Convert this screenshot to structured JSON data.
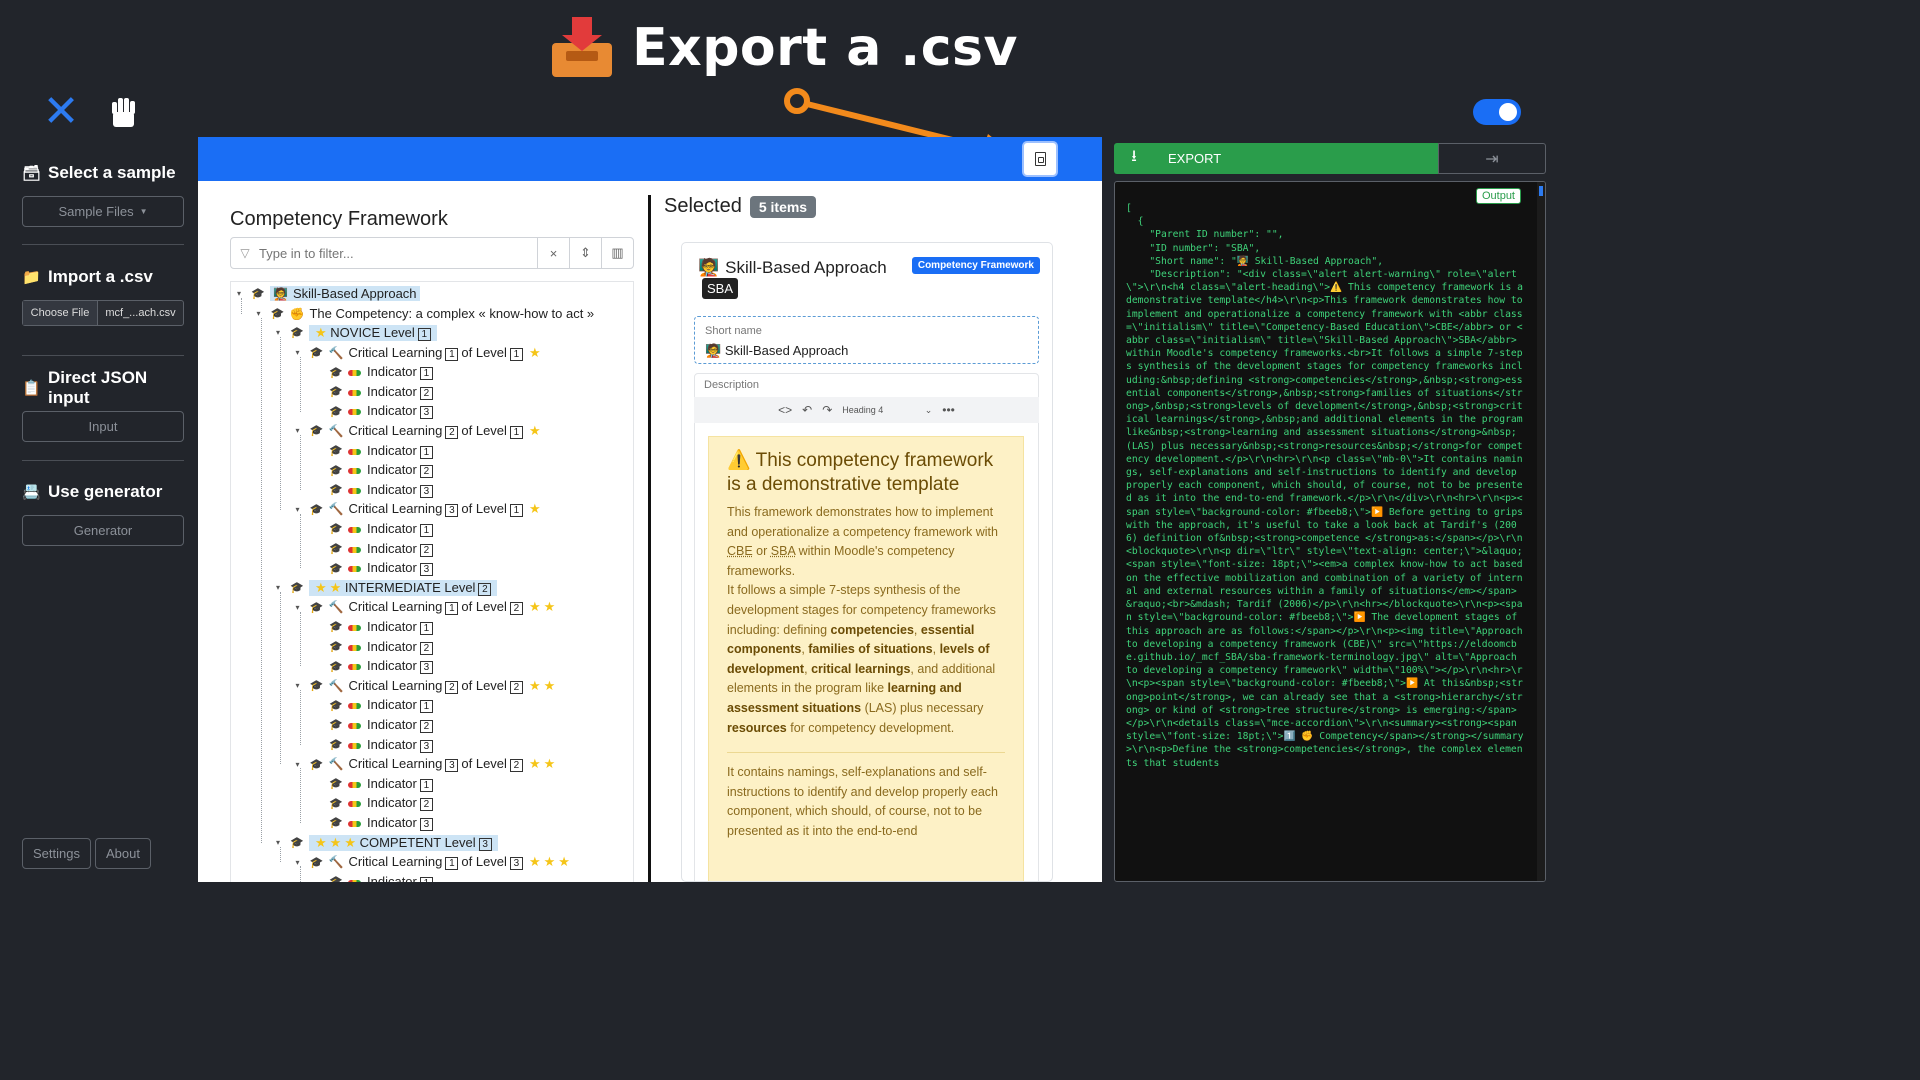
{
  "banner": {
    "title": "Export a .csv",
    "icon": "inbox-tray-icon"
  },
  "header": {
    "close_icon": "close-icon",
    "fist_icon": "fist-icon",
    "toggle_on": true
  },
  "sidebar": {
    "sample": {
      "heading": "Select a sample",
      "button": "Sample Files"
    },
    "import": {
      "heading": "Import a .csv",
      "choose_label": "Choose File",
      "file_name": "mcf_...ach.csv"
    },
    "json": {
      "heading": "Direct JSON input",
      "button": "Input"
    },
    "generator": {
      "heading": "Use generator",
      "button": "Generator"
    },
    "settings": "Settings",
    "about": "About"
  },
  "framework": {
    "title": "Competency Framework",
    "filter_placeholder": "Type in to filter...",
    "tree": [
      {
        "lvl": 0,
        "toggle": "▾",
        "text": "Skill-Based Approach",
        "icon": "🧑‍🏫",
        "hl": true
      },
      {
        "lvl": 1,
        "toggle": "▾",
        "text": "The Competency: a complex « know-how to act »",
        "icon": "✊"
      },
      {
        "lvl": 2,
        "toggle": "▾",
        "pre": "NOVICE Level",
        "num": "1",
        "stars": 0,
        "lead_stars": 1,
        "hl": true
      },
      {
        "lvl": 3,
        "toggle": "▾",
        "pre": "Critical Learning",
        "num": "1",
        "post": "of Level",
        "num2": "1",
        "stars": 1,
        "icon": "🔨"
      },
      {
        "lvl": 4,
        "pre": "Indicator",
        "num": "1",
        "ind": true
      },
      {
        "lvl": 4,
        "pre": "Indicator",
        "num": "2",
        "ind": true
      },
      {
        "lvl": 4,
        "pre": "Indicator",
        "num": "3",
        "ind": true
      },
      {
        "lvl": 3,
        "toggle": "▾",
        "pre": "Critical Learning",
        "num": "2",
        "post": "of Level",
        "num2": "1",
        "stars": 1,
        "icon": "🔨"
      },
      {
        "lvl": 4,
        "pre": "Indicator",
        "num": "1",
        "ind": true
      },
      {
        "lvl": 4,
        "pre": "Indicator",
        "num": "2",
        "ind": true
      },
      {
        "lvl": 4,
        "pre": "Indicator",
        "num": "3",
        "ind": true
      },
      {
        "lvl": 3,
        "toggle": "▾",
        "pre": "Critical Learning",
        "num": "3",
        "post": "of Level",
        "num2": "1",
        "stars": 1,
        "icon": "🔨"
      },
      {
        "lvl": 4,
        "pre": "Indicator",
        "num": "1",
        "ind": true
      },
      {
        "lvl": 4,
        "pre": "Indicator",
        "num": "2",
        "ind": true
      },
      {
        "lvl": 4,
        "pre": "Indicator",
        "num": "3",
        "ind": true
      },
      {
        "lvl": 2,
        "toggle": "▾",
        "pre": "INTERMEDIATE Level",
        "num": "2",
        "lead_stars": 2,
        "hl": true
      },
      {
        "lvl": 3,
        "toggle": "▾",
        "pre": "Critical Learning",
        "num": "1",
        "post": "of Level",
        "num2": "2",
        "stars": 2,
        "icon": "🔨"
      },
      {
        "lvl": 4,
        "pre": "Indicator",
        "num": "1",
        "ind": true
      },
      {
        "lvl": 4,
        "pre": "Indicator",
        "num": "2",
        "ind": true
      },
      {
        "lvl": 4,
        "pre": "Indicator",
        "num": "3",
        "ind": true
      },
      {
        "lvl": 3,
        "toggle": "▾",
        "pre": "Critical Learning",
        "num": "2",
        "post": "of Level",
        "num2": "2",
        "stars": 2,
        "icon": "🔨"
      },
      {
        "lvl": 4,
        "pre": "Indicator",
        "num": "1",
        "ind": true
      },
      {
        "lvl": 4,
        "pre": "Indicator",
        "num": "2",
        "ind": true
      },
      {
        "lvl": 4,
        "pre": "Indicator",
        "num": "3",
        "ind": true
      },
      {
        "lvl": 3,
        "toggle": "▾",
        "pre": "Critical Learning",
        "num": "3",
        "post": "of Level",
        "num2": "2",
        "stars": 2,
        "icon": "🔨"
      },
      {
        "lvl": 4,
        "pre": "Indicator",
        "num": "1",
        "ind": true
      },
      {
        "lvl": 4,
        "pre": "Indicator",
        "num": "2",
        "ind": true
      },
      {
        "lvl": 4,
        "pre": "Indicator",
        "num": "3",
        "ind": true
      },
      {
        "lvl": 2,
        "toggle": "▾",
        "pre": "COMPETENT Level",
        "num": "3",
        "lead_stars": 3,
        "hl": true
      },
      {
        "lvl": 3,
        "toggle": "▾",
        "pre": "Critical Learning",
        "num": "1",
        "post": "of Level",
        "num2": "3",
        "stars": 3,
        "icon": "🔨"
      },
      {
        "lvl": 4,
        "pre": "Indicator",
        "num": "1",
        "ind": true
      }
    ]
  },
  "selected": {
    "title": "Selected",
    "count_badge": "5 items",
    "card": {
      "name": "Skill-Based Approach",
      "type_badge": "Competency Framework",
      "id_badge": "SBA",
      "short_name_label": "Short name",
      "short_name_value": "Skill-Based Approach",
      "description_label": "Description",
      "heading_select": "Heading 4",
      "alert_heading": "This competency framework is a demonstrative template",
      "p1a": "This framework demonstrates how to implement and operationalize a competency framework with ",
      "abbr1": "CBE",
      "p1b": " or ",
      "abbr2": "SBA",
      "p1c": " within Moodle's competency frameworks.",
      "p2a": "It follows a simple 7-steps synthesis of the development stages for competency frameworks including: defining ",
      "b1": "competencies",
      "b2": "essential components",
      "b3": "families of situations",
      "b4": "levels of development",
      "b5": "critical learnings",
      "p2b": ", and additional elements in the program like ",
      "b6": "learning and assessment situations",
      "p2c": " (LAS) plus necessary ",
      "b7": "resources",
      "p2d": " for competency development.",
      "p3": "It contains namings, self-explanations and self-instructions to identify and develop properly each component, which should, of course, not to be presented as it into the end-to-end"
    }
  },
  "export": {
    "button": "EXPORT",
    "output_badge": "Output",
    "json_text": "[\n  {\n    \"Parent ID number\": \"\",\n    \"ID number\": \"SBA\",\n    \"Short name\": \"🧑‍🏫 Skill-Based Approach\",\n    \"Description\": \"<div class=\\\"alert alert-warning\\\" role=\\\"alert\\\">\\r\\n<h4 class=\\\"alert-heading\\\">⚠️ This competency framework is a demonstrative template</h4>\\r\\n<p>This framework demonstrates how to implement and operationalize a competency framework with <abbr class=\\\"initialism\\\" title=\\\"Competency-Based Education\\\">CBE</abbr> or <abbr class=\\\"initialism\\\" title=\\\"Skill-Based Approach\\\">SBA</abbr> within Moodle's competency frameworks.<br>It follows a simple 7-steps synthesis of the development stages for competency frameworks including:&nbsp;defining <strong>competencies</strong>,&nbsp;<strong>essential components</strong>,&nbsp;<strong>families of situations</strong>,&nbsp;<strong>levels of development</strong>,&nbsp;<strong>critical learnings</strong>,&nbsp;and additional elements in the program like&nbsp;<strong>learning and assessment situations</strong>&nbsp;(LAS) plus necessary&nbsp;<strong>resources&nbsp;</strong>for competency development.</p>\\r\\n<hr>\\r\\n<p class=\\\"mb-0\\\">It contains namings, self-explanations and self-instructions to identify and develop properly each component, which should, of course, not to be presented as it into the end-to-end framework.</p>\\r\\n</div>\\r\\n<hr>\\r\\n<p><span style=\\\"background-color: #fbeeb8;\\\">▶️ Before getting to grips with the approach, it's useful to take a look back at Tardif's (2006) definition of&nbsp;<strong>competence </strong>as:</span></p>\\r\\n<blockquote>\\r\\n<p dir=\\\"ltr\\\" style=\\\"text-align: center;\\\">&laquo; <span style=\\\"font-size: 18pt;\\\"><em>a complex know-how to act based on the effective mobilization and combination of a variety of internal and external resources within a family of situations</em></span> &raquo;<br>&mdash; Tardif (2006)</p>\\r\\n<hr></blockquote>\\r\\n<p><span style=\\\"background-color: #fbeeb8;\\\">▶️ The development stages of this approach are as follows:</span></p>\\r\\n<p><img title=\\\"Approach to developing a competency framework (CBE)\\\" src=\\\"https://eldoomcbe.github.io/_mcf_SBA/sba-framework-terminology.jpg\\\" alt=\\\"Approach to developing a competency framework\\\" width=\\\"100%\\\"></p>\\r\\n<hr>\\r\\n<p><span style=\\\"background-color: #fbeeb8;\\\">▶️ At this&nbsp;<strong>point</strong>, we can already see that a <strong>hierarchy</strong> or kind of <strong>tree structure</strong> is emerging:</span></p>\\r\\n<details class=\\\"mce-accordion\\\">\\r\\n<summary><strong><span style=\\\"font-size: 18pt;\\\">1️⃣ ✊ Competency</span></strong></summary>\\r\\n<p>Define the <strong>competencies</strong>, the complex elements that students"
  },
  "colors": {
    "accent": "#1a6ef5",
    "export_green": "#2a9d4b",
    "annotation": "#f28a1c",
    "highlight": "#cde4f5"
  }
}
